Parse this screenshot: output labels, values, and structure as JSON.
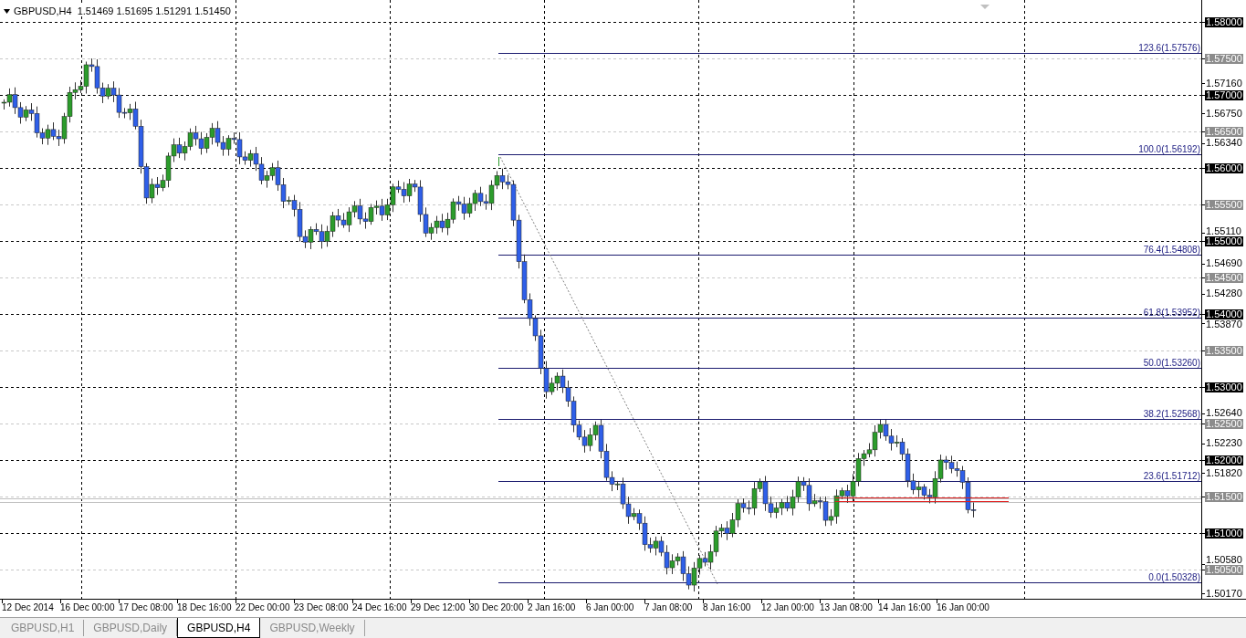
{
  "chart": {
    "header": "GBPUSD,H4  1.51469 1.51695 1.51291 1.51450",
    "fib_levels": [
      {
        "label": "123.6(1.57576)"
      },
      {
        "label": "100.0(1.56192)"
      },
      {
        "label": "76.4(1.54808)"
      },
      {
        "label": "61.8(1.53952)"
      },
      {
        "label": "50.0(1.53260)"
      },
      {
        "label": "38.2(1.52568)"
      },
      {
        "label": "23.6(1.51712)"
      },
      {
        "label": "0.0(1.50328)"
      }
    ]
  },
  "price_axis": [
    {
      "text": "1.58000",
      "kind": "level"
    },
    {
      "text": "1.57500",
      "kind": "half"
    },
    {
      "text": "1.57160",
      "kind": "tick"
    },
    {
      "text": "1.57000",
      "kind": "level"
    },
    {
      "text": "1.56750",
      "kind": "tick"
    },
    {
      "text": "1.56500",
      "kind": "half"
    },
    {
      "text": "1.56340",
      "kind": "tick"
    },
    {
      "text": "1.56000",
      "kind": "level"
    },
    {
      "text": "1.55500",
      "kind": "half"
    },
    {
      "text": "1.55110",
      "kind": "tick"
    },
    {
      "text": "1.55000",
      "kind": "level"
    },
    {
      "text": "1.54690",
      "kind": "tick"
    },
    {
      "text": "1.54500",
      "kind": "half"
    },
    {
      "text": "1.54280",
      "kind": "tick"
    },
    {
      "text": "1.54000",
      "kind": "level"
    },
    {
      "text": "1.53870",
      "kind": "tick"
    },
    {
      "text": "1.53500",
      "kind": "half"
    },
    {
      "text": "1.53000",
      "kind": "level"
    },
    {
      "text": "1.52640",
      "kind": "tick"
    },
    {
      "text": "1.52500",
      "kind": "half"
    },
    {
      "text": "1.52230",
      "kind": "tick"
    },
    {
      "text": "1.52000",
      "kind": "level"
    },
    {
      "text": "1.51820",
      "kind": "tick"
    },
    {
      "text": "1.51500",
      "kind": "half"
    },
    {
      "text": "1.51000",
      "kind": "level"
    },
    {
      "text": "1.50580",
      "kind": "tick"
    },
    {
      "text": "1.50500",
      "kind": "half"
    },
    {
      "text": "1.50170",
      "kind": "tick"
    }
  ],
  "time_axis": [
    "12 Dec 2014",
    "16 Dec 00:00",
    "17 Dec 08:00",
    "18 Dec 16:00",
    "22 Dec 00:00",
    "23 Dec 08:00",
    "24 Dec 16:00",
    "29 Dec 12:00",
    "30 Dec 20:00",
    "2 Jan 16:00",
    "6 Jan 00:00",
    "7 Jan 08:00",
    "8 Jan 16:00",
    "12 Jan 00:00",
    "13 Jan 08:00",
    "14 Jan 16:00",
    "16 Jan 00:00"
  ],
  "tabs": [
    {
      "label": "GBPUSD,H1",
      "selected": false
    },
    {
      "label": "GBPUSD,Daily",
      "selected": false
    },
    {
      "label": "GBPUSD,H4",
      "selected": true
    },
    {
      "label": "GBPUSD,Weekly",
      "selected": false
    }
  ]
}
